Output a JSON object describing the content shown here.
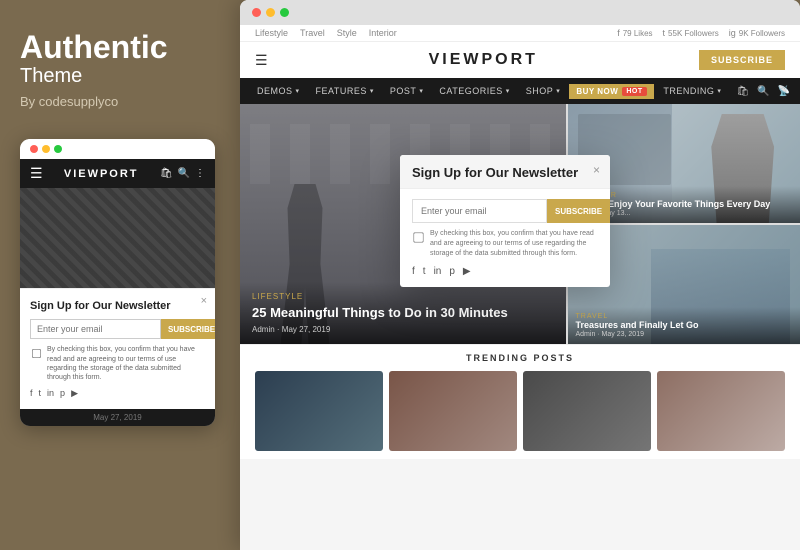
{
  "left_panel": {
    "brand_title": "Authentic",
    "brand_subtitle": "Theme",
    "brand_by": "By codesupplyco"
  },
  "mobile": {
    "nav": {
      "logo": "VIEWPORT"
    },
    "newsletter": {
      "title": "Sign Up for Our Newsletter",
      "email_placeholder": "Enter your email",
      "subscribe_label": "SUBSCRIBE",
      "checkbox_text": "By checking this box, you confirm that you have read and are agreeing to our terms of use regarding the storage of the data submitted through this form."
    },
    "bottom_bar": "May 27, 2019"
  },
  "desktop": {
    "topbar": {
      "links": [
        "Lifestyle",
        "Travel",
        "Style",
        "Interior"
      ],
      "social": [
        {
          "icon": "f",
          "count": "79 Likes"
        },
        {
          "icon": "t",
          "count": "55K Followers"
        },
        {
          "icon": "i",
          "count": "9K Followers"
        }
      ]
    },
    "header": {
      "logo": "VIEWPORT",
      "subscribe_label": "SUBSCRIBE"
    },
    "nav": {
      "items": [
        "DEMOS",
        "FEATURES",
        "POST",
        "CATEGORIES",
        "SHOP"
      ],
      "buy_now": "BUY NOW",
      "hot_badge": "HOT",
      "trending": "TRENDING",
      "right_icons": [
        "bag",
        "search",
        "rss"
      ]
    },
    "featured": {
      "main": {
        "category": "Lifestyle",
        "title": "25 Meaningful Things to Do in 30 Minutes",
        "meta": "Admin · May 27, 2019"
      },
      "top_right": {
        "category": "Interior",
        "title": "How to Enjoy Your Favorite Things Every Day",
        "meta": "Admin · May 13..."
      },
      "bottom_right": {
        "category": "Travel",
        "title": "Treasures and Finally Let Go",
        "meta": "Admin · May 23, 2019"
      }
    },
    "trending_posts_label": "TRENDING POSTS",
    "newsletter_popup": {
      "title": "Sign Up for Our Newsletter",
      "email_placeholder": "Enter your email",
      "subscribe_label": "SUBSCRIBE",
      "checkbox_text": "By checking this box, you confirm that you have read and are agreeing to our terms of use regarding the storage of the data submitted through this form.",
      "close": "×"
    }
  }
}
